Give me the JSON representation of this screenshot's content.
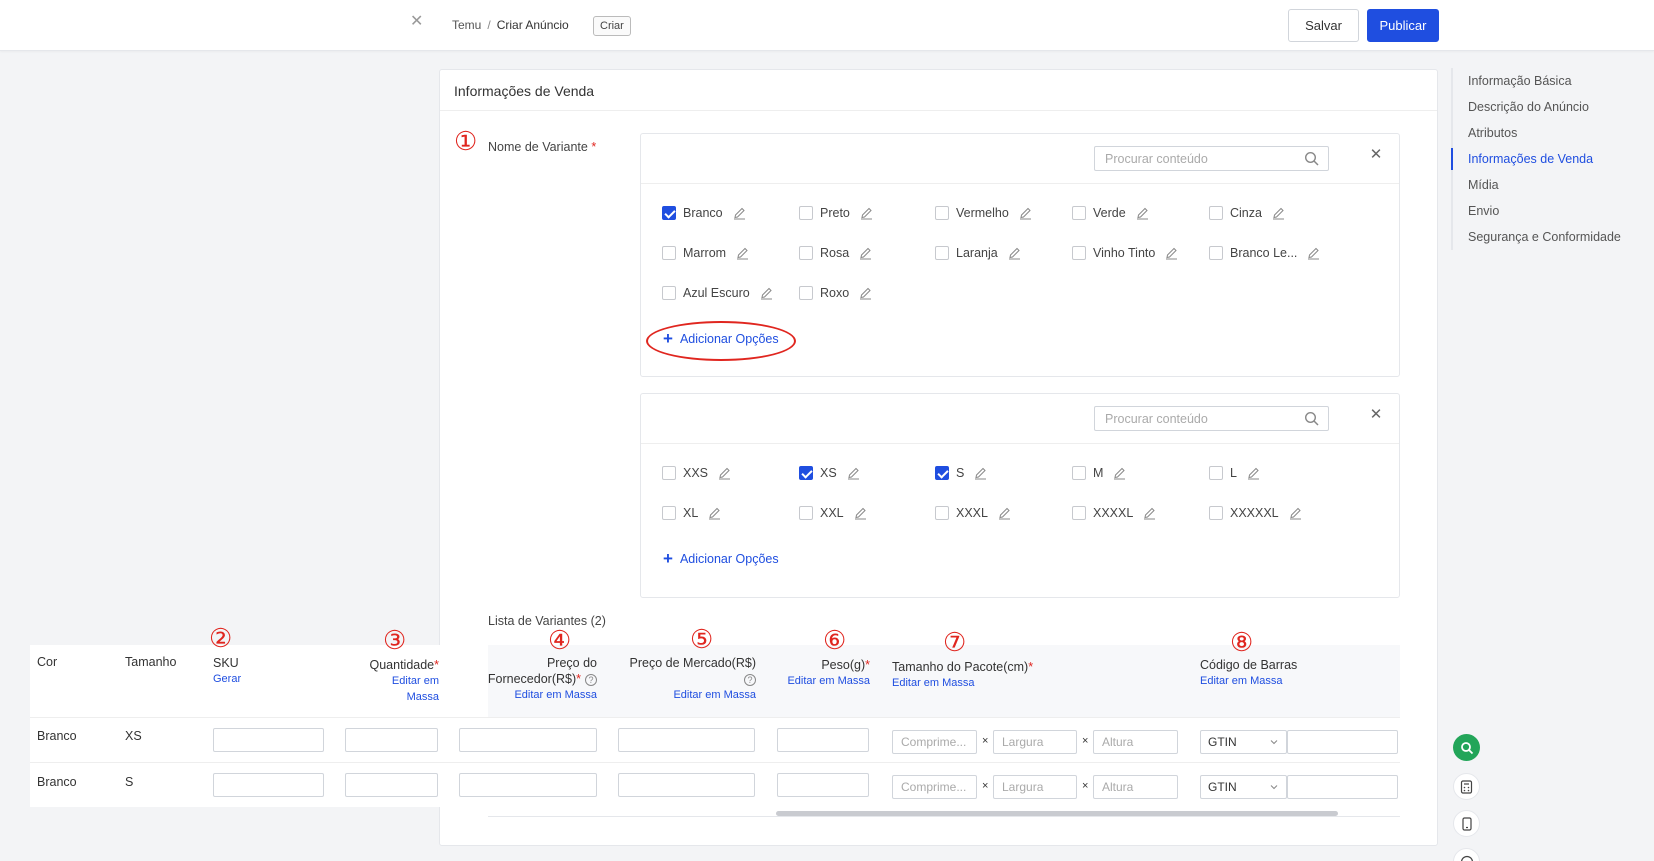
{
  "topbar": {
    "breadcrumb_root": "Temu",
    "breadcrumb_sep": "/",
    "breadcrumb_current": "Criar Anúncio",
    "tag": "Criar",
    "save_label": "Salvar",
    "publish_label": "Publicar"
  },
  "rightnav": {
    "items": [
      {
        "label": "Informação Básica"
      },
      {
        "label": "Descrição do Anúncio"
      },
      {
        "label": "Atributos"
      },
      {
        "label": "Informações de Venda"
      },
      {
        "label": "Mídia"
      },
      {
        "label": "Envio"
      },
      {
        "label": "Segurança e Conformidade"
      }
    ],
    "active": "Informações de Venda"
  },
  "section": {
    "title": "Informações de Venda",
    "variant_label": "Nome de Variante",
    "required_mark": "*",
    "annotations": [
      "①",
      "②",
      "③",
      "④",
      "⑤",
      "⑥",
      "⑦",
      "⑧"
    ]
  },
  "color_panel": {
    "search_placeholder": "Procurar conteúdo",
    "options": [
      {
        "label": "Branco",
        "checked": true
      },
      {
        "label": "Preto",
        "checked": false
      },
      {
        "label": "Vermelho",
        "checked": false
      },
      {
        "label": "Verde",
        "checked": false
      },
      {
        "label": "Cinza",
        "checked": false
      },
      {
        "label": "Marrom",
        "checked": false
      },
      {
        "label": "Rosa",
        "checked": false
      },
      {
        "label": "Laranja",
        "checked": false
      },
      {
        "label": "Vinho Tinto",
        "checked": false
      },
      {
        "label": "Branco Le...",
        "checked": false
      },
      {
        "label": "Azul Escuro",
        "checked": false
      },
      {
        "label": "Roxo",
        "checked": false
      }
    ],
    "add_label": "Adicionar Opções"
  },
  "size_panel": {
    "search_placeholder": "Procurar conteúdo",
    "options": [
      {
        "label": "XXS",
        "checked": false
      },
      {
        "label": "XS",
        "checked": true
      },
      {
        "label": "S",
        "checked": true
      },
      {
        "label": "M",
        "checked": false
      },
      {
        "label": "L",
        "checked": false
      },
      {
        "label": "XL",
        "checked": false
      },
      {
        "label": "XXL",
        "checked": false
      },
      {
        "label": "XXXL",
        "checked": false
      },
      {
        "label": "XXXXL",
        "checked": false
      },
      {
        "label": "XXXXXL",
        "checked": false
      }
    ],
    "add_label": "Adicionar Opções"
  },
  "variant_list": {
    "title": "Lista de Variantes (2)",
    "headers": {
      "cor": "Cor",
      "tamanho": "Tamanho",
      "sku": "SKU",
      "sku_link": "Gerar",
      "quantidade": "Quantidade",
      "preco_fornecedor_1": "Preço do",
      "preco_fornecedor_2": "Fornecedor(R$)",
      "preco_mercado": "Preço de Mercado(R$)",
      "peso": "Peso(g)",
      "tamanho_pacote": "Tamanho do Pacote(cm)",
      "codigo_barras": "Código de Barras",
      "bulk_edit": "Editar em Massa",
      "help_icon": "?"
    },
    "rows": [
      {
        "cor": "Branco",
        "tamanho": "XS"
      },
      {
        "cor": "Branco",
        "tamanho": "S"
      }
    ],
    "placeholders": {
      "comprimento": "Comprime...",
      "largura": "Largura",
      "altura": "Altura"
    },
    "times_symbol": "×",
    "barcode_type": "GTIN"
  },
  "colors": {
    "primary": "#1f4ee0",
    "danger": "#e0261f",
    "fab_green": "#22a559"
  }
}
